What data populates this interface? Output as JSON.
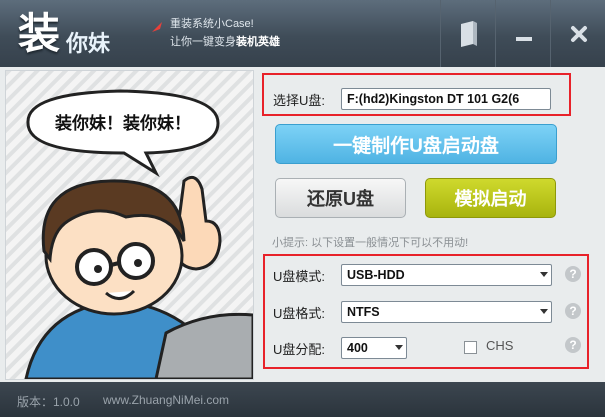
{
  "app": {
    "logo_big": "装",
    "logo_small": "你妹",
    "slogan_line1": "重装系统小Case!",
    "slogan_line2_prefix": "让你一键变身",
    "slogan_line2_bold": "装机英雄",
    "window_buttons": [
      {
        "name": "skin-icon"
      },
      {
        "name": "minimize-icon",
        "glyph": "—"
      },
      {
        "name": "close-icon",
        "glyph": "✖"
      }
    ]
  },
  "illustration": {
    "speech_text": "装你妹！装你妹！"
  },
  "usb": {
    "label": "选择U盘:",
    "selected": "F:(hd2)Kingston DT 101 G2(6"
  },
  "buttons": {
    "make_boot": "一键制作U盘启动盘",
    "restore": "还原U盘",
    "simulate": "模拟启动"
  },
  "hint": "小提示: 以下设置一般情况下可以不用动!",
  "settings": {
    "mode_label": "U盘模式:",
    "mode_value": "USB-HDD",
    "format_label": "U盘格式:",
    "format_value": "NTFS",
    "partition_label": "U盘分配:",
    "partition_value": "400",
    "chs_label": "CHS",
    "chs_checked": false,
    "help_glyph": "?"
  },
  "status": {
    "version": "版本：1.0.0",
    "website": "www.ZhuangNiMei.com"
  },
  "colors": {
    "titlebar": "#3f4c58",
    "primary_button": "#5fc0ec",
    "simulate_button": "#b7c417",
    "highlight_frame": "#e8222a"
  }
}
